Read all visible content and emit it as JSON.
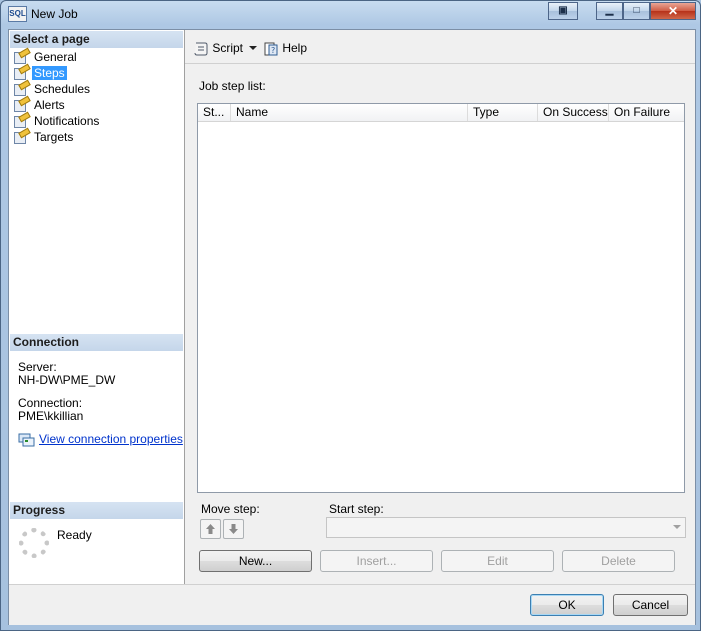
{
  "window": {
    "title": "New Job",
    "app_icon_text": "SQL"
  },
  "sidebar": {
    "select_page_header": "Select a page",
    "pages": [
      {
        "label": "General",
        "selected": false
      },
      {
        "label": "Steps",
        "selected": true
      },
      {
        "label": "Schedules",
        "selected": false
      },
      {
        "label": "Alerts",
        "selected": false
      },
      {
        "label": "Notifications",
        "selected": false
      },
      {
        "label": "Targets",
        "selected": false
      }
    ],
    "connection_header": "Connection",
    "server_label": "Server:",
    "server_value": "NH-DW\\PME_DW",
    "connection_label": "Connection:",
    "connection_value": "PME\\kkillian",
    "connection_link": "View connection properties",
    "progress_header": "Progress",
    "progress_status": "Ready"
  },
  "toolbar": {
    "script_label": "Script",
    "help_label": "Help"
  },
  "main": {
    "job_step_list_label": "Job step list:",
    "columns": [
      "St...",
      "Name",
      "Type",
      "On Success",
      "On Failure"
    ],
    "rows": [],
    "move_step_label": "Move step:",
    "start_step_label": "Start step:",
    "start_step_value": "",
    "buttons": {
      "new": "New...",
      "insert": "Insert...",
      "edit": "Edit",
      "delete": "Delete"
    }
  },
  "footer": {
    "ok": "OK",
    "cancel": "Cancel"
  },
  "colors": {
    "selection": "#3399ff",
    "link": "#0033cc",
    "frame": "#a9c3df"
  }
}
